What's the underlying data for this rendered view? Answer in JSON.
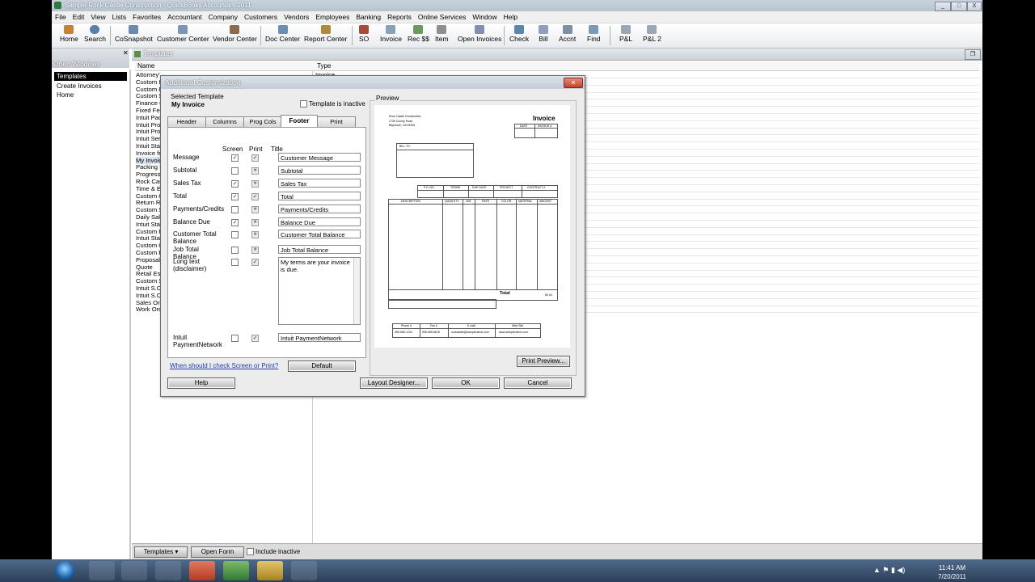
{
  "window": {
    "title": "Sample Rock Castle Construction - QuickBooks Accountant 2011",
    "btn_min": "_",
    "btn_max": "□",
    "btn_close": "X"
  },
  "menu": [
    "File",
    "Edit",
    "View",
    "Lists",
    "Favorites",
    "Accountant",
    "Company",
    "Customers",
    "Vendors",
    "Employees",
    "Banking",
    "Reports",
    "Online Services",
    "Window",
    "Help"
  ],
  "toolbar": [
    "Home",
    "Search",
    "CoSnapshot",
    "Customer Center",
    "Vendor Center",
    "Doc Center",
    "Report Center",
    "SO",
    "Invoice",
    "Rec $$",
    "Item",
    "Open Invoices",
    "Check",
    "Bill",
    "Accnt",
    "Find",
    "P&L",
    "P&L 2"
  ],
  "open_windows": {
    "title": "Open Windows",
    "items": [
      "Templates",
      "Create Invoices",
      "Home"
    ],
    "selected": 0
  },
  "templates": {
    "title": "Templates",
    "col_name": "Name",
    "col_type": "Type",
    "first_row_type": "Invoice",
    "rows": [
      "Attorney's Invoice",
      "Custom In",
      "Custom P",
      "Custom S",
      "Finance C",
      "Fixed Fee",
      "Intuit Pac",
      "Intuit Pro",
      "Intuit Pro",
      "Intuit Ser",
      "Intuit Sta",
      "Invoice fr",
      "My Invoic",
      "Packing S",
      "Progress",
      "Rock Cas",
      "Time & Ex",
      "Custom C",
      "Return Re",
      "Custom S",
      "Daily Sale",
      "Intuit Sta",
      "Custom P",
      "Intuit Sta",
      "Custom C",
      "Custom E",
      "Proposal",
      "Quote",
      "Retail Est",
      "Custom S",
      "Intuit S.C",
      "Intuit S.C",
      "Sales Ord",
      "Work Ord"
    ],
    "footer": {
      "templates_btn": "Templates ▾",
      "open_form_btn": "Open Form",
      "include_inactive": "Include inactive"
    }
  },
  "dialog": {
    "title": "Additional Customization",
    "selected_template_label": "Selected Template",
    "selected_template": "My Invoice",
    "inactive_label": "Template is inactive",
    "tabs": [
      "Header",
      "Columns",
      "Prog Cols",
      "Footer",
      "Print"
    ],
    "active_tab": "Footer",
    "col_screen": "Screen",
    "col_print": "Print",
    "col_title": "Title",
    "rows": [
      {
        "label": "Message",
        "screen": true,
        "print": true,
        "title": "Customer Message"
      },
      {
        "label": "Subtotal",
        "screen": false,
        "print": false,
        "title": "Subtotal"
      },
      {
        "label": "Sales Tax",
        "screen": true,
        "print": false,
        "title": "Sales Tax"
      },
      {
        "label": "Total",
        "screen": true,
        "print": true,
        "title": "Total"
      },
      {
        "label": "Payments/Credits",
        "screen": false,
        "print": false,
        "title": "Payments/Credits"
      },
      {
        "label": "Balance Due",
        "screen": true,
        "print": false,
        "title": "Balance Due"
      },
      {
        "label": "Customer Total Balance",
        "screen": false,
        "print": false,
        "title": "Customer Total Balance"
      },
      {
        "label": "Job Total Balance",
        "screen": false,
        "print": false,
        "title": "Job Total Balance"
      },
      {
        "label": "Long text (disclaimer)",
        "screen": false,
        "print": true,
        "title": "My terms are your invoice is due."
      },
      {
        "label": "Intuit PaymentNetwork",
        "screen": false,
        "print": true,
        "title": "Intuit PaymentNetwork"
      }
    ],
    "help_link": "When should I check Screen or Print?",
    "default_btn": "Default",
    "help_btn": "Help",
    "layout_btn": "Layout Designer...",
    "ok_btn": "OK",
    "cancel_btn": "Cancel",
    "preview_label": "Preview",
    "print_preview_btn": "Print Preview...",
    "invoice": {
      "company": "Rock Castle Construction",
      "addr1": "1735 County Road",
      "addr2": "Bayshore, CA 94326",
      "heading": "Invoice",
      "date_hdr": "DATE",
      "num_hdr": "INVOICE #",
      "bill_to": "BILL TO",
      "mid_headers": [
        "P.O. NO.",
        "TERMS",
        "DUE DATE",
        "PROJECT",
        "CONTRACT #"
      ],
      "line_headers": [
        "DESCRIPTION",
        "QUANTITY",
        "U/M",
        "RATE",
        "COLOR",
        "MATERIAL",
        "AMOUNT"
      ],
      "total_label": "Total",
      "total_value": "$0.00",
      "contact_headers": [
        "Phone #",
        "Fax #",
        "E-mail",
        "Web Site"
      ],
      "contact_values": [
        "555-555-1234",
        "555-555-5678",
        "rockcastle@samplename.com",
        "www.samplename.com"
      ]
    }
  },
  "taskbar": {
    "time": "11:41 AM",
    "date": "7/20/2011"
  }
}
